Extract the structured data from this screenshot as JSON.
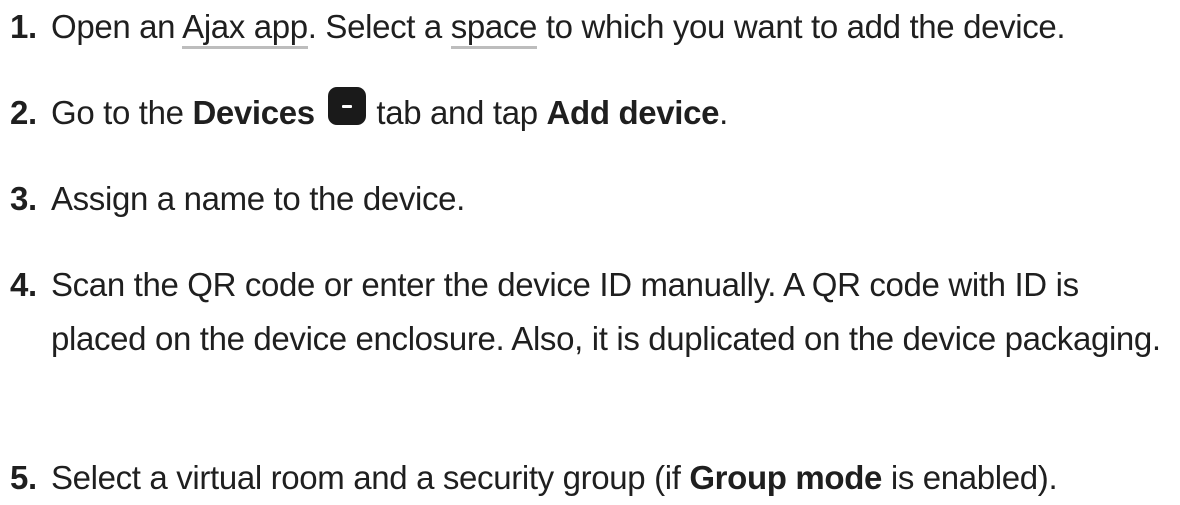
{
  "steps": [
    {
      "number": "1.",
      "parts": {
        "t1": "Open an ",
        "link1": "Ajax app",
        "t2": ". Select a ",
        "link2": "space",
        "t3": " to which you want to add the device."
      }
    },
    {
      "number": "2.",
      "parts": {
        "t1": "Go to the ",
        "b1": "Devices",
        "icon": "devices-icon",
        "t2": " tab and tap ",
        "b2": "Add device",
        "t3": "."
      }
    },
    {
      "number": "3.",
      "parts": {
        "t1": "Assign a name to the device."
      }
    },
    {
      "number": "4.",
      "parts": {
        "t1": "Scan the QR code or enter the device ID manually. A QR code with ID is placed on the device enclosure. Also, it is duplicated on the device packaging."
      }
    },
    {
      "number": "5.",
      "parts": {
        "t1": "Select a virtual room and a security group (if ",
        "b1": "Group mode",
        "t2": " is enabled)."
      }
    }
  ]
}
